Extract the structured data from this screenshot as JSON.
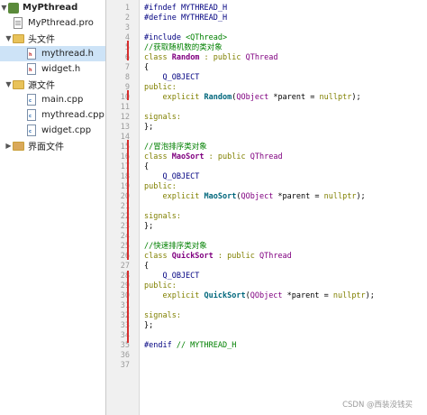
{
  "tree": {
    "project": "MyPthread",
    "items": [
      {
        "label": "MyPthread.pro"
      },
      {
        "label": "头文件"
      },
      {
        "label": "mythread.h"
      },
      {
        "label": "widget.h"
      },
      {
        "label": "源文件"
      },
      {
        "label": "main.cpp"
      },
      {
        "label": "mythread.cpp"
      },
      {
        "label": "widget.cpp"
      },
      {
        "label": "界面文件"
      }
    ]
  },
  "line_numbers": [
    "1",
    "2",
    "3",
    "4",
    "5",
    "6",
    "7",
    "8",
    "9",
    "10",
    "11",
    "12",
    "13",
    "14",
    "15",
    "16",
    "17",
    "18",
    "19",
    "20",
    "21",
    "22",
    "23",
    "24",
    "25",
    "26",
    "27",
    "28",
    "29",
    "30",
    "31",
    "32",
    "33",
    "34",
    "35",
    "36",
    "37"
  ],
  "code": {
    "l1": "#ifndef MYTHREAD_H",
    "l2": "#define MYTHREAD_H",
    "l4a": "#include ",
    "l4b": "<QThread>",
    "l5": "//获取随机数的类对象",
    "l6a": "class ",
    "l6b": "Random",
    "l6c": " : public ",
    "l6d": "QThread",
    "l7": "{",
    "l8": "    Q_OBJECT",
    "l9": "public:",
    "l10a": "    explicit ",
    "l10b": "Random",
    "l10c": "(",
    "l10d": "QObject",
    "l10e": " *parent = ",
    "l10f": "nullptr",
    "l10g": ");",
    "l12": "signals:",
    "l13": "};",
    "l16": "//冒泡排序类对象",
    "l17a": "class ",
    "l17b": "MaoSort",
    "l17c": " : public ",
    "l17d": "QThread",
    "l18": "{",
    "l19": "    Q_OBJECT",
    "l20": "public:",
    "l21a": "    explicit ",
    "l21b": "MaoSort",
    "l21c": "(",
    "l21d": "QObject",
    "l21e": " *parent = ",
    "l21f": "nullptr",
    "l21g": ");",
    "l23": "signals:",
    "l24": "};",
    "l26": "//快速排序类对象",
    "l27a": "class ",
    "l27b": "QuickSort",
    "l27c": " : public ",
    "l27d": "QThread",
    "l28": "{",
    "l29": "    Q_OBJECT",
    "l30": "public:",
    "l31a": "    explicit ",
    "l31b": "QuickSort",
    "l31c": "(",
    "l31d": "QObject",
    "l31e": " *parent = ",
    "l31f": "nullptr",
    "l31g": ");",
    "l33": "signals:",
    "l34": "};",
    "l36a": "#endif ",
    "l36b": "// MYTHREAD_H"
  },
  "watermark": "CSDN @西装没钱买",
  "colors": {
    "keyword": "#808000",
    "preprocessor": "#000080",
    "comment": "#008000",
    "class_name": "#800080",
    "change_marker": "#d62d2d",
    "selection": "#cde3f7"
  }
}
